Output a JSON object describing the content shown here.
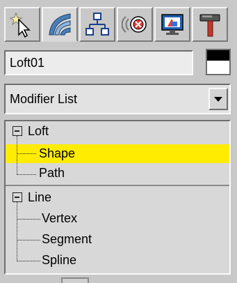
{
  "tabs": [
    {
      "name": "create-tab",
      "icon": "create-cursor-star-icon"
    },
    {
      "name": "modify-tab",
      "icon": "modify-curve-icon"
    },
    {
      "name": "hierarchy-tab",
      "icon": "hierarchy-icon"
    },
    {
      "name": "motion-tab",
      "icon": "motion-icon"
    },
    {
      "name": "display-tab",
      "icon": "display-monitor-icon"
    },
    {
      "name": "utilities-tab",
      "icon": "utilities-hammer-icon"
    }
  ],
  "object": {
    "name": "Loft01",
    "color_top": "#000000",
    "color_bottom": "#ffffff"
  },
  "modifier_list": {
    "label": "Modifier List"
  },
  "stack": {
    "items": [
      {
        "label": "Loft"
      },
      {
        "label": "Shape"
      },
      {
        "label": "Path"
      },
      {
        "label": "Line"
      },
      {
        "label": "Vertex"
      },
      {
        "label": "Segment"
      },
      {
        "label": "Spline"
      }
    ]
  },
  "colors": {
    "panel": "#c8c8c8",
    "selected": "#ffec00"
  }
}
